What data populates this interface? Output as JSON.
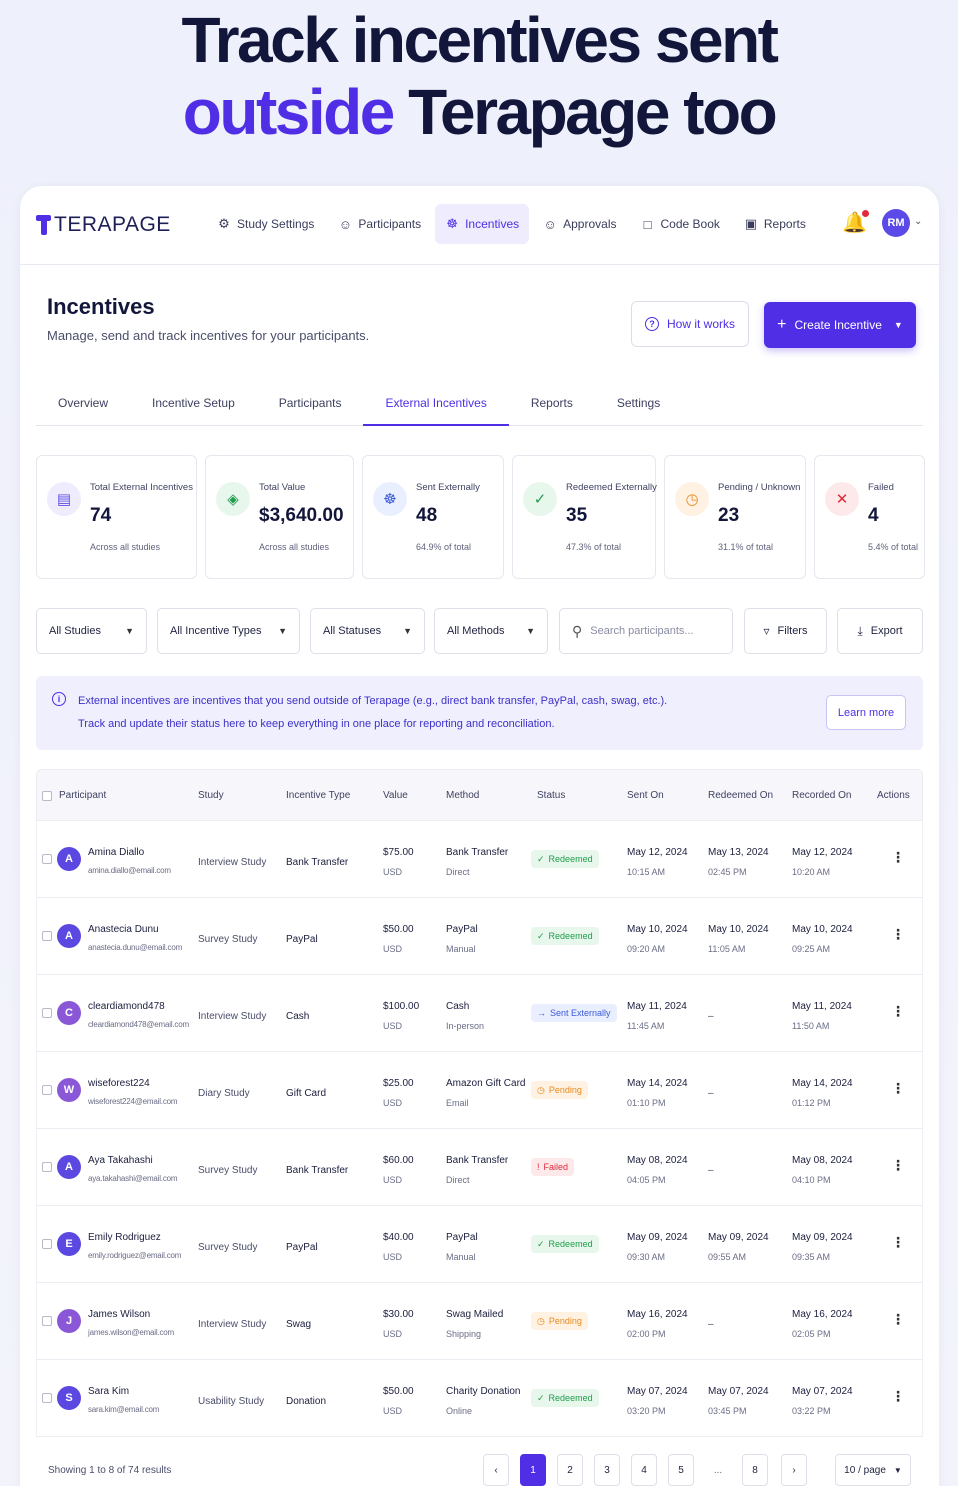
{
  "hero": {
    "line1": "Track incentives sent",
    "line2_accent": "outside",
    "line2_rest": " Terapage too"
  },
  "brand": {
    "name": "TERAPAGE",
    "accent_color": "#4f2ee6"
  },
  "nav": {
    "items": [
      {
        "label": "Study Settings",
        "icon": "gear-icon"
      },
      {
        "label": "Participants",
        "icon": "users-icon"
      },
      {
        "label": "Incentives",
        "icon": "gift-icon",
        "active": true
      },
      {
        "label": "Approvals",
        "icon": "user-check-icon"
      },
      {
        "label": "Code Book",
        "icon": "book-icon"
      },
      {
        "label": "Reports",
        "icon": "video-icon"
      }
    ],
    "avatar_initials": "RM"
  },
  "page": {
    "title": "Incentives",
    "subtitle": "Manage, send and track incentives for your participants.",
    "how_label": "How it works",
    "create_label": "Create Incentive"
  },
  "tabs": [
    "Overview",
    "Incentive Setup",
    "Participants",
    "External Incentives",
    "Reports",
    "Settings"
  ],
  "stats": [
    {
      "label": "Total External Incentives",
      "value": "74",
      "note": "Across all studies",
      "color": "#5b4ae8",
      "bg": "#eeecfd",
      "icon": "wallet-icon"
    },
    {
      "label": "Total Value",
      "value": "$3,640.00",
      "note": "Across all studies",
      "color": "#1f9d4c",
      "bg": "#e8f7ec",
      "icon": "money-bag-icon"
    },
    {
      "label": "Sent Externally",
      "value": "48",
      "note": "64.9% of total",
      "color": "#3a5ad9",
      "bg": "#e9efff",
      "icon": "gift-icon"
    },
    {
      "label": "Redeemed Externally",
      "value": "35",
      "note": "47.3% of total",
      "color": "#1f9d4c",
      "bg": "#e8f7ec",
      "icon": "check-circle-icon"
    },
    {
      "label": "Pending / Unknown",
      "value": "23",
      "note": "31.1% of total",
      "color": "#e98a21",
      "bg": "#fff2e3",
      "icon": "clock-icon"
    },
    {
      "label": "Failed",
      "value": "4",
      "note": "5.4% of total",
      "color": "#db2c3c",
      "bg": "#fde9ea",
      "icon": "x-circle-icon"
    }
  ],
  "filters": {
    "studies": "All Studies",
    "types": "All Incentive Types",
    "statuses": "All Statuses",
    "methods": "All Methods",
    "search_placeholder": "Search participants...",
    "filters_label": "Filters",
    "export_label": "Export"
  },
  "info": {
    "line1": "External incentives are incentives that you send outside of Terapage (e.g., direct bank transfer, PayPal, cash, swag, etc.).",
    "line2": "Track and update their status here to keep everything in one place for reporting and reconciliation.",
    "learn_label": "Learn more"
  },
  "table": {
    "headers": [
      "Participant",
      "Study",
      "Incentive Type",
      "Value",
      "Method",
      "Status",
      "Sent On",
      "Redeemed On",
      "Recorded On",
      "Actions"
    ],
    "rows": [
      {
        "initial": "A",
        "avatar": "blue",
        "name": "Amina Diallo",
        "email": "amina.diallo@email.com",
        "study": "Interview Study",
        "type": "Bank Transfer",
        "value": "$75.00",
        "currency": "USD",
        "method": "Bank Transfer",
        "method_sub": "Direct",
        "status": "Redeemed",
        "status_kind": "redeemed",
        "sent_date": "May 12, 2024",
        "sent_time": "10:15 AM",
        "red_date": "May 13, 2024",
        "red_time": "02:45 PM",
        "rec_date": "May 12, 2024",
        "rec_time": "10:20 AM"
      },
      {
        "initial": "A",
        "avatar": "blue",
        "name": "Anastecia Dunu",
        "email": "anastecia.dunu@email.com",
        "study": "Survey Study",
        "type": "PayPal",
        "value": "$50.00",
        "currency": "USD",
        "method": "PayPal",
        "method_sub": "Manual",
        "status": "Redeemed",
        "status_kind": "redeemed",
        "sent_date": "May 10, 2024",
        "sent_time": "09:20 AM",
        "red_date": "May 10, 2024",
        "red_time": "11:05 AM",
        "rec_date": "May 10, 2024",
        "rec_time": "09:25 AM"
      },
      {
        "initial": "C",
        "avatar": "purple",
        "name": "cleardiamond478",
        "email": "cleardiamond478@email.com",
        "study": "Interview Study",
        "type": "Cash",
        "value": "$100.00",
        "currency": "USD",
        "method": "Cash",
        "method_sub": "In-person",
        "status": "Sent Externally",
        "status_kind": "sent",
        "sent_date": "May 11, 2024",
        "sent_time": "11:45 AM",
        "red_date": "–",
        "red_time": "",
        "rec_date": "May 11, 2024",
        "rec_time": "11:50 AM"
      },
      {
        "initial": "W",
        "avatar": "purple",
        "name": "wiseforest224",
        "email": "wiseforest224@email.com",
        "study": "Diary Study",
        "type": "Gift Card",
        "value": "$25.00",
        "currency": "USD",
        "method": "Amazon Gift Card",
        "method_sub": "Email",
        "status": "Pending",
        "status_kind": "pending",
        "sent_date": "May 14, 2024",
        "sent_time": "01:10 PM",
        "red_date": "–",
        "red_time": "",
        "rec_date": "May 14, 2024",
        "rec_time": "01:12 PM"
      },
      {
        "initial": "A",
        "avatar": "blue",
        "name": "Aya Takahashi",
        "email": "aya.takahashi@email.com",
        "study": "Survey Study",
        "type": "Bank Transfer",
        "value": "$60.00",
        "currency": "USD",
        "method": "Bank Transfer",
        "method_sub": "Direct",
        "status": "Failed",
        "status_kind": "failed",
        "sent_date": "May 08, 2024",
        "sent_time": "04:05 PM",
        "red_date": "–",
        "red_time": "",
        "rec_date": "May 08, 2024",
        "rec_time": "04:10 PM"
      },
      {
        "initial": "E",
        "avatar": "blue",
        "name": "Emily Rodriguez",
        "email": "emily.rodriguez@email.com",
        "study": "Survey Study",
        "type": "PayPal",
        "value": "$40.00",
        "currency": "USD",
        "method": "PayPal",
        "method_sub": "Manual",
        "status": "Redeemed",
        "status_kind": "redeemed",
        "sent_date": "May 09, 2024",
        "sent_time": "09:30 AM",
        "red_date": "May 09, 2024",
        "red_time": "09:55 AM",
        "rec_date": "May 09, 2024",
        "rec_time": "09:35 AM"
      },
      {
        "initial": "J",
        "avatar": "purple",
        "name": "James Wilson",
        "email": "james.wilson@email.com",
        "study": "Interview Study",
        "type": "Swag",
        "value": "$30.00",
        "currency": "USD",
        "method": "Swag Mailed",
        "method_sub": "Shipping",
        "status": "Pending",
        "status_kind": "pending",
        "sent_date": "May 16, 2024",
        "sent_time": "02:00 PM",
        "red_date": "–",
        "red_time": "",
        "rec_date": "May 16, 2024",
        "rec_time": "02:05 PM"
      },
      {
        "initial": "S",
        "avatar": "blue",
        "name": "Sara Kim",
        "email": "sara.kim@email.com",
        "study": "Usability Study",
        "type": "Donation",
        "value": "$50.00",
        "currency": "USD",
        "method": "Charity Donation",
        "method_sub": "Online",
        "status": "Redeemed",
        "status_kind": "redeemed",
        "sent_date": "May 07, 2024",
        "sent_time": "03:20 PM",
        "red_date": "May 07, 2024",
        "red_time": "03:45 PM",
        "rec_date": "May 07, 2024",
        "rec_time": "03:22 PM"
      }
    ]
  },
  "pagination": {
    "summary": "Showing 1 to 8 of 74 results",
    "prev": "‹",
    "next": "›",
    "pages": [
      "1",
      "2",
      "3",
      "4",
      "5",
      "...",
      "8"
    ],
    "current": "1",
    "per_page": "10 / page"
  }
}
